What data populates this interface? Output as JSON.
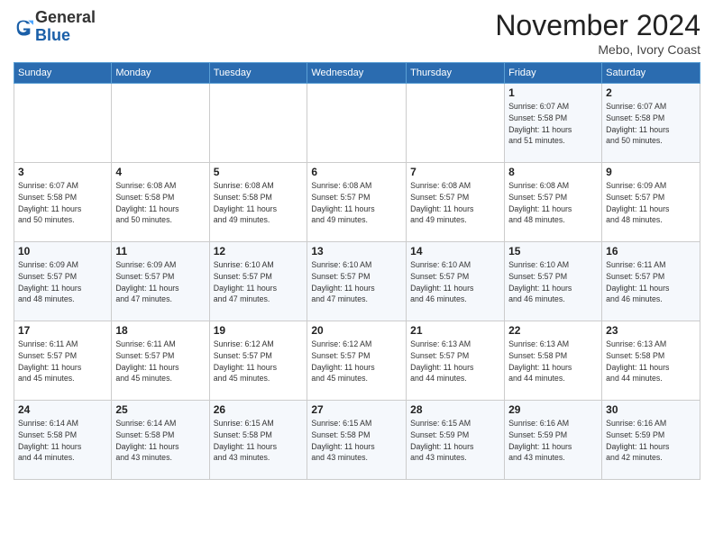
{
  "logo": {
    "general": "General",
    "blue": "Blue"
  },
  "title": "November 2024",
  "location": "Mebo, Ivory Coast",
  "days_header": [
    "Sunday",
    "Monday",
    "Tuesday",
    "Wednesday",
    "Thursday",
    "Friday",
    "Saturday"
  ],
  "weeks": [
    [
      {
        "day": "",
        "info": ""
      },
      {
        "day": "",
        "info": ""
      },
      {
        "day": "",
        "info": ""
      },
      {
        "day": "",
        "info": ""
      },
      {
        "day": "",
        "info": ""
      },
      {
        "day": "1",
        "info": "Sunrise: 6:07 AM\nSunset: 5:58 PM\nDaylight: 11 hours\nand 51 minutes."
      },
      {
        "day": "2",
        "info": "Sunrise: 6:07 AM\nSunset: 5:58 PM\nDaylight: 11 hours\nand 50 minutes."
      }
    ],
    [
      {
        "day": "3",
        "info": "Sunrise: 6:07 AM\nSunset: 5:58 PM\nDaylight: 11 hours\nand 50 minutes."
      },
      {
        "day": "4",
        "info": "Sunrise: 6:08 AM\nSunset: 5:58 PM\nDaylight: 11 hours\nand 50 minutes."
      },
      {
        "day": "5",
        "info": "Sunrise: 6:08 AM\nSunset: 5:58 PM\nDaylight: 11 hours\nand 49 minutes."
      },
      {
        "day": "6",
        "info": "Sunrise: 6:08 AM\nSunset: 5:57 PM\nDaylight: 11 hours\nand 49 minutes."
      },
      {
        "day": "7",
        "info": "Sunrise: 6:08 AM\nSunset: 5:57 PM\nDaylight: 11 hours\nand 49 minutes."
      },
      {
        "day": "8",
        "info": "Sunrise: 6:08 AM\nSunset: 5:57 PM\nDaylight: 11 hours\nand 48 minutes."
      },
      {
        "day": "9",
        "info": "Sunrise: 6:09 AM\nSunset: 5:57 PM\nDaylight: 11 hours\nand 48 minutes."
      }
    ],
    [
      {
        "day": "10",
        "info": "Sunrise: 6:09 AM\nSunset: 5:57 PM\nDaylight: 11 hours\nand 48 minutes."
      },
      {
        "day": "11",
        "info": "Sunrise: 6:09 AM\nSunset: 5:57 PM\nDaylight: 11 hours\nand 47 minutes."
      },
      {
        "day": "12",
        "info": "Sunrise: 6:10 AM\nSunset: 5:57 PM\nDaylight: 11 hours\nand 47 minutes."
      },
      {
        "day": "13",
        "info": "Sunrise: 6:10 AM\nSunset: 5:57 PM\nDaylight: 11 hours\nand 47 minutes."
      },
      {
        "day": "14",
        "info": "Sunrise: 6:10 AM\nSunset: 5:57 PM\nDaylight: 11 hours\nand 46 minutes."
      },
      {
        "day": "15",
        "info": "Sunrise: 6:10 AM\nSunset: 5:57 PM\nDaylight: 11 hours\nand 46 minutes."
      },
      {
        "day": "16",
        "info": "Sunrise: 6:11 AM\nSunset: 5:57 PM\nDaylight: 11 hours\nand 46 minutes."
      }
    ],
    [
      {
        "day": "17",
        "info": "Sunrise: 6:11 AM\nSunset: 5:57 PM\nDaylight: 11 hours\nand 45 minutes."
      },
      {
        "day": "18",
        "info": "Sunrise: 6:11 AM\nSunset: 5:57 PM\nDaylight: 11 hours\nand 45 minutes."
      },
      {
        "day": "19",
        "info": "Sunrise: 6:12 AM\nSunset: 5:57 PM\nDaylight: 11 hours\nand 45 minutes."
      },
      {
        "day": "20",
        "info": "Sunrise: 6:12 AM\nSunset: 5:57 PM\nDaylight: 11 hours\nand 45 minutes."
      },
      {
        "day": "21",
        "info": "Sunrise: 6:13 AM\nSunset: 5:57 PM\nDaylight: 11 hours\nand 44 minutes."
      },
      {
        "day": "22",
        "info": "Sunrise: 6:13 AM\nSunset: 5:58 PM\nDaylight: 11 hours\nand 44 minutes."
      },
      {
        "day": "23",
        "info": "Sunrise: 6:13 AM\nSunset: 5:58 PM\nDaylight: 11 hours\nand 44 minutes."
      }
    ],
    [
      {
        "day": "24",
        "info": "Sunrise: 6:14 AM\nSunset: 5:58 PM\nDaylight: 11 hours\nand 44 minutes."
      },
      {
        "day": "25",
        "info": "Sunrise: 6:14 AM\nSunset: 5:58 PM\nDaylight: 11 hours\nand 43 minutes."
      },
      {
        "day": "26",
        "info": "Sunrise: 6:15 AM\nSunset: 5:58 PM\nDaylight: 11 hours\nand 43 minutes."
      },
      {
        "day": "27",
        "info": "Sunrise: 6:15 AM\nSunset: 5:58 PM\nDaylight: 11 hours\nand 43 minutes."
      },
      {
        "day": "28",
        "info": "Sunrise: 6:15 AM\nSunset: 5:59 PM\nDaylight: 11 hours\nand 43 minutes."
      },
      {
        "day": "29",
        "info": "Sunrise: 6:16 AM\nSunset: 5:59 PM\nDaylight: 11 hours\nand 43 minutes."
      },
      {
        "day": "30",
        "info": "Sunrise: 6:16 AM\nSunset: 5:59 PM\nDaylight: 11 hours\nand 42 minutes."
      }
    ]
  ]
}
